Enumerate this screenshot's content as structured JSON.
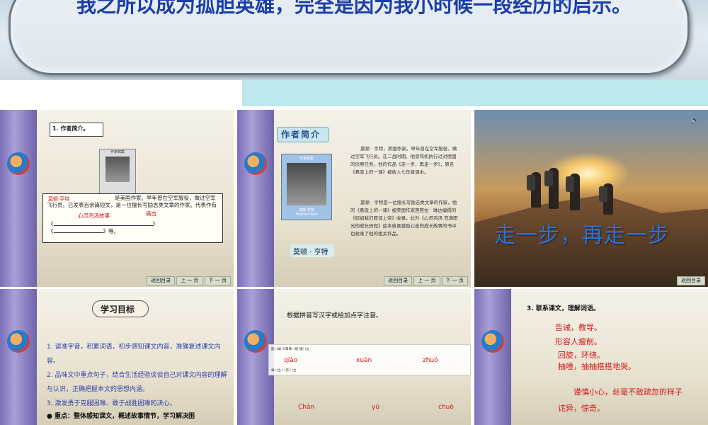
{
  "banner": {
    "title": "我之所以成为孤胆英雄，完全是因为我小时候一段经历的启示。"
  },
  "nav": {
    "back": "返回目录",
    "prev": "上 一 页",
    "next": "下 一 页"
  },
  "slide1": {
    "heading": "1. 作者简介。",
    "card_label": "作家档案",
    "name": "莫顿·亨特",
    "text": "是美国作家。早年曾在空军服役，做过空军飞行员。已发表百余篇短文，是一位擅长写励志类文章的作家。代表作有",
    "annot1": "心灵鸡汤故事",
    "annot2": "痛击",
    "blank1": "《",
    "blank1_end": "》",
    "blank2": "《",
    "blank2_end": "》等。"
  },
  "slide2": {
    "heading": "作者简介",
    "card_label": "作家档案",
    "card_name": "莫顿·亨特",
    "card_name_en": "Morton Hunt",
    "caption": "莫顿 · 亨特",
    "para1": "莫顿 · 亨特，美国作家。早年曾在空军服役，做过空军飞行员。在二战时期，他曾驾机执行过对德国的侦察任务。他的作品《走一步，再走一步》，原名《悬崖上的一课》被收入七年级课本。",
    "para2": "莫顿 · 亨特是一位擅长写励志类文章的作家，他的《悬崖上的一课》被美国作家芭芭拉 · 琳达编撰的《假如我们原谅上帝》收录。此外《心灵鸡汤 充满阳光的成长历程》这本收录激励心志的成长故事的书中也收录了他的相关作品。"
  },
  "slide3": {
    "caption": "走一步，再走一步",
    "back": "返回目录"
  },
  "slide4": {
    "heading": "学习目标",
    "goals": [
      "1. 读准字音，积累词语，初步感知课文内容，准确复述课文内容。",
      "2. 品味文中重点句子，结合生活经验谈谈自己对课文内容的理解与认识，正确把握本文的思想内涵。",
      "3. 激发勇于克服困难、敢于战胜困难的决心。"
    ],
    "key": "● 重点：整体感知课文，概述故事情节，学习解决困"
  },
  "slide5": {
    "heading": "根据拼音写汉字或给加点字注音。",
    "row1": "陡(    )峭    头晕目(    )眩    啜(    )泣",
    "pinyin1": [
      "qiào",
      "xuàn",
      "zhuó"
    ],
    "row2": "耸(    )立    (    )迟    (    )立",
    "pinyin2": [
      "Chàn",
      "yū",
      "chuò"
    ]
  },
  "slide6": {
    "heading": "3. 联系课文，理解词语。",
    "answers": [
      "告诫，教导。",
      "形容人瘦削。",
      "回旋，环绕。",
      "抽噎，抽抽搭搭地哭。",
      "谨慎小心，丝毫不敢疏忽的样子",
      "诧异，惊奇。"
    ]
  }
}
